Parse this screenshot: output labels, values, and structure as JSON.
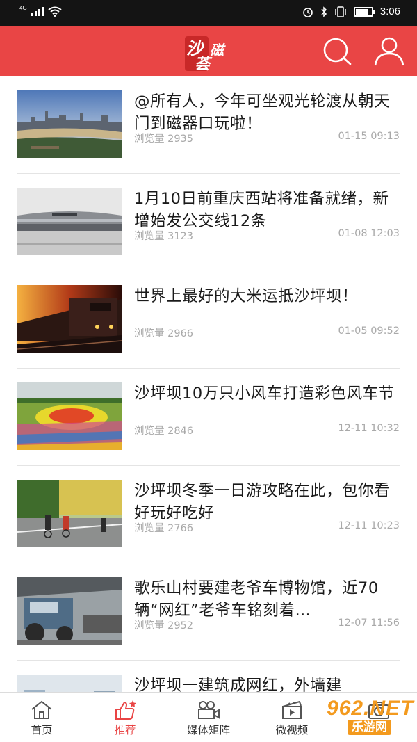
{
  "status_bar": {
    "network": "4G",
    "time": "3:06",
    "battery_level": 0.85
  },
  "header": {
    "logo_chars": [
      "沙",
      "磁",
      "荟"
    ],
    "logo_icon": "shacihui-logo",
    "search_icon": "search-icon",
    "user_icon": "user-icon",
    "bg_color": "#e94545"
  },
  "news": [
    {
      "title": "@所有人，今年可坐观光轮渡从朝天门到磁器口玩啦！",
      "views": "浏览量 2935",
      "time": "01-15 09:13"
    },
    {
      "title": "1月10日前重庆西站将准备就绪，新增始发公交线12条",
      "views": "浏览量 3123",
      "time": "01-08 12:03"
    },
    {
      "title": "世界上最好的大米运抵沙坪坝！",
      "views": "浏览量 2966",
      "time": "01-05 09:52"
    },
    {
      "title": "沙坪坝10万只小风车打造彩色风车节",
      "views": "浏览量 2846",
      "time": "12-11 10:32"
    },
    {
      "title": "沙坪坝冬季一日游攻略在此，包你看好玩好吃好",
      "views": "浏览量 2766",
      "time": "12-11 10:23"
    },
    {
      "title": "歌乐山村要建老爷车博物馆，近70辆“网红”老爷车铭刻着…",
      "views": "浏览量 2952",
      "time": "12-07 11:56"
    },
    {
      "title": "沙坪坝一建筑成网红，外墙建",
      "views": "",
      "time": ""
    }
  ],
  "bottom_nav": [
    {
      "label": "首页",
      "icon": "home-icon"
    },
    {
      "label": "推荐",
      "icon": "thumbs-up-icon",
      "active": true
    },
    {
      "label": "媒体矩阵",
      "icon": "video-camera-icon"
    },
    {
      "label": "微视频",
      "icon": "clapperboard-icon"
    },
    {
      "label": "",
      "icon": "camera-icon"
    }
  ],
  "watermark": {
    "text_big": "962.NET",
    "text_small": "乐游网"
  }
}
